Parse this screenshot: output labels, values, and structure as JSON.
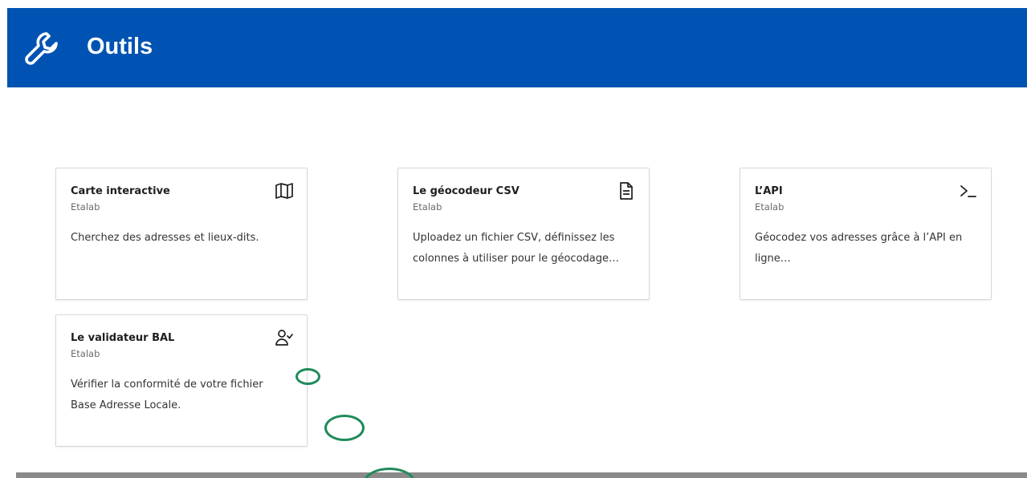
{
  "header": {
    "title": "Outils",
    "icon": "wrench-icon",
    "background": "#0053b3"
  },
  "cards": [
    {
      "title": "Carte interactive",
      "author": "Etalab",
      "description": "Cherchez des adresses et lieux-dits.",
      "icon": "map-icon"
    },
    {
      "title": "Le géocodeur CSV",
      "author": "Etalab",
      "description": "Uploadez un fichier CSV, définissez les colonnes à utiliser pour le géocodage…",
      "icon": "document-icon"
    },
    {
      "title": "L’API",
      "author": "Etalab",
      "description": "Géocodez vos adresses grâce à l’API en ligne…",
      "icon": "terminal-icon"
    },
    {
      "title": "Le validateur BAL",
      "author": "Etalab",
      "description": "Vérifier la conformité de votre fichier Base Adresse Locale.",
      "icon": "user-check-icon"
    }
  ],
  "colors": {
    "header": "#0053b3",
    "marker": "#1f8a5a",
    "footer": "#8a8a8a"
  }
}
